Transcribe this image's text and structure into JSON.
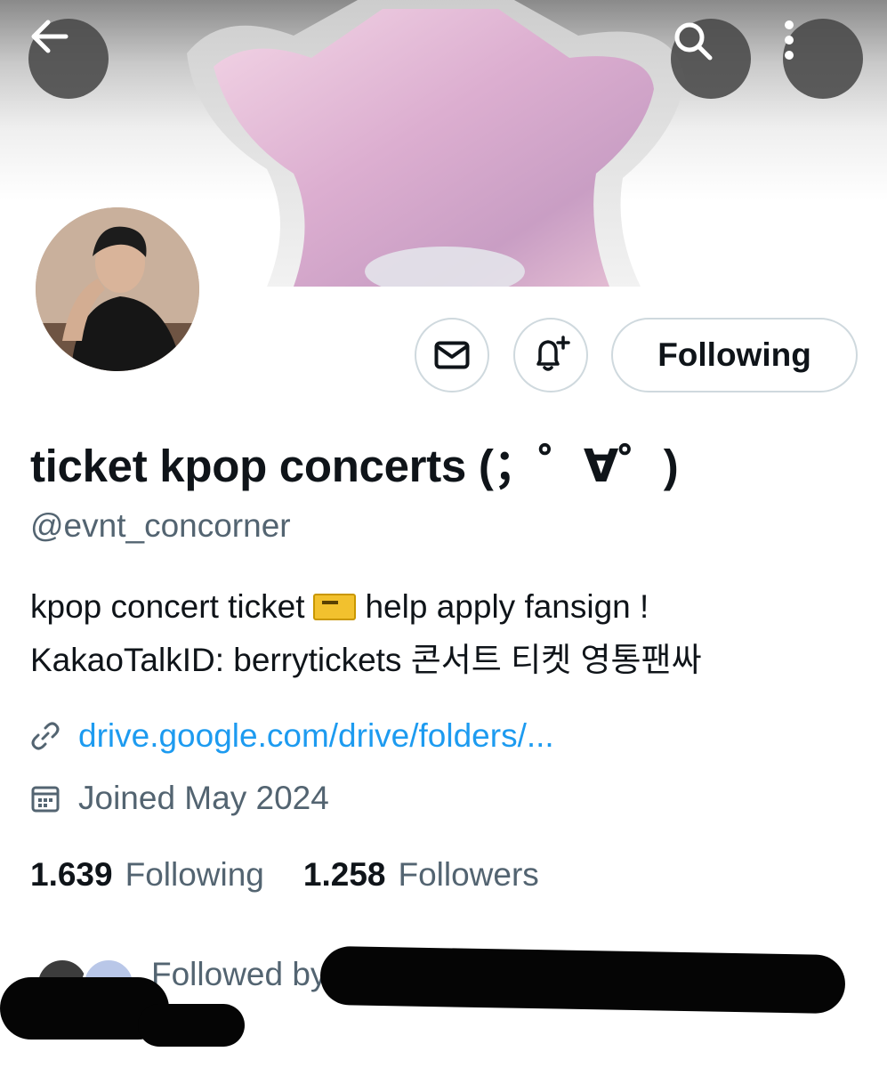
{
  "header": {
    "back_icon": "arrow-left-icon",
    "search_icon": "search-icon",
    "more_icon": "more-vertical-icon"
  },
  "actions": {
    "message_icon": "envelope-icon",
    "notify_icon": "bell-plus-icon",
    "follow_label": "Following"
  },
  "profile": {
    "display_name": "ticket kpop concerts (；゜∀゜)",
    "handle": "@evnt_concorner",
    "bio_line1_a": "kpop concert ticket",
    "bio_line1_b": "help apply fansign !",
    "bio_line2": "KakaoTalkID: berrytickets 콘서트 티켓 영통팬싸",
    "link": "drive.google.com/drive/folders/...",
    "joined": "Joined May 2024"
  },
  "stats": {
    "following_count": "1.639",
    "following_label": "Following",
    "followers_count": "1.258",
    "followers_label": "Followers"
  },
  "followed_by": {
    "label": "Followed by"
  },
  "colors": {
    "link": "#1d9bf0",
    "secondary_text": "#536471",
    "border": "#cfd9de"
  }
}
